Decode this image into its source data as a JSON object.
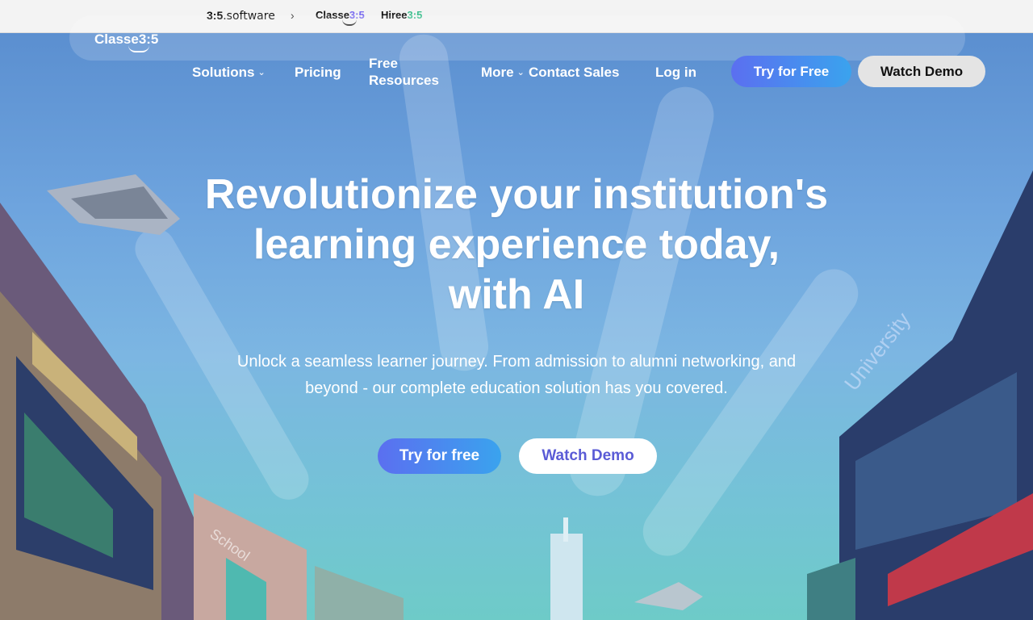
{
  "brandbar": {
    "brand1_num": "3:5",
    "brand1_rest": ".software",
    "separator": "›",
    "brand2_text": "Classe",
    "brand2_hl": "3:5",
    "brand3_text": "Hiree",
    "brand3_hl": "3:5"
  },
  "nav": {
    "logo_text": "Classe3:5",
    "solutions": "Solutions",
    "pricing": "Pricing",
    "free_resources_1": "Free",
    "free_resources_2": "Resources",
    "more": "More",
    "contact_sales": "Contact Sales",
    "login": "Log in",
    "try_free": "Try for Free",
    "watch_demo": "Watch Demo",
    "caret": "⌄"
  },
  "hero": {
    "headline_1": "Revolutionize your institution's",
    "headline_2": "learning experience today,",
    "headline_3": "with AI",
    "sub_1": "Unlock a seamless learner journey. From admission to alumni networking, and",
    "sub_2": "beyond - our complete education solution has you covered.",
    "cta_try": "Try for free",
    "cta_demo": "Watch Demo"
  },
  "colors": {
    "accent_gradient_start": "#5b6ff0",
    "accent_gradient_end": "#3aa3ee",
    "demo_text": "#5a5bd6"
  }
}
